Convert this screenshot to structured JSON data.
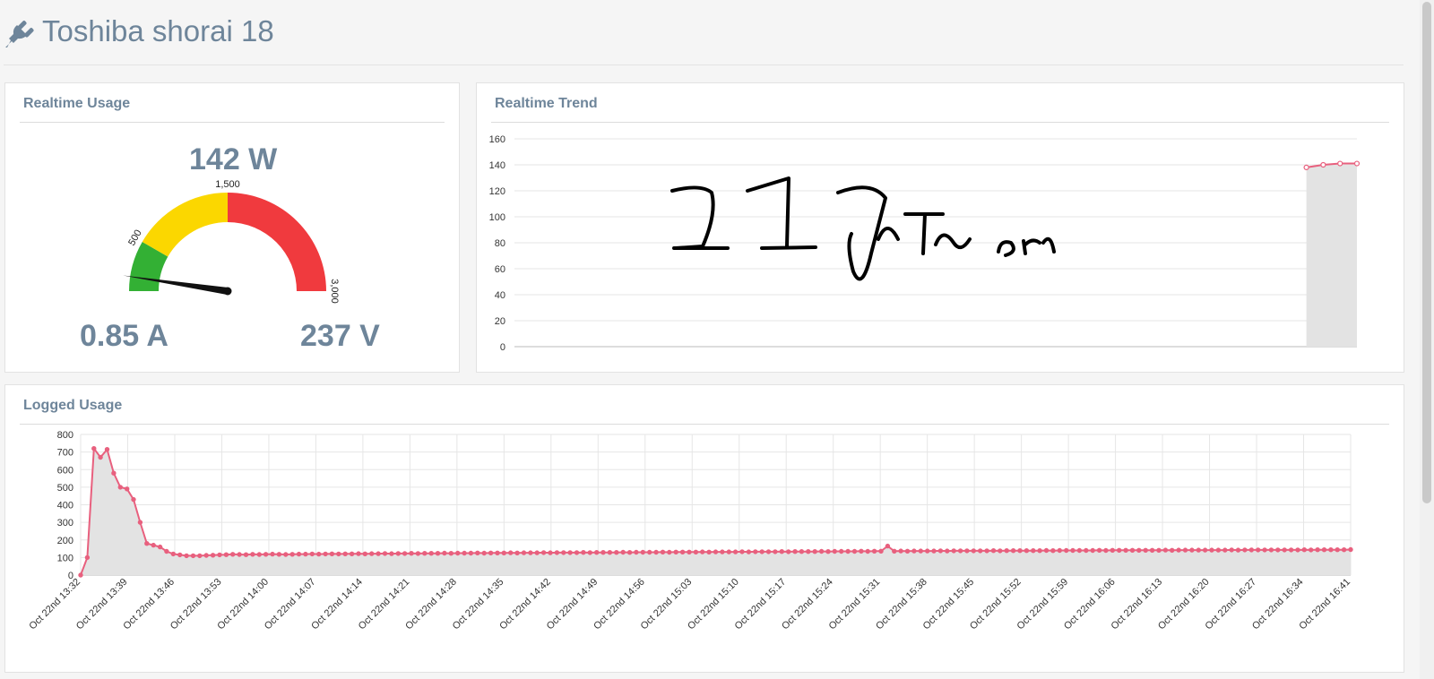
{
  "page": {
    "title": "Toshiba shorai 18",
    "icon": "plug-icon"
  },
  "colors": {
    "text": "#6e859a",
    "line": "#e8607e",
    "fill": "#e3e3e3",
    "gauge_green": "#33b034",
    "gauge_yellow": "#fbd700",
    "gauge_red": "#f03a3e"
  },
  "realtime_usage": {
    "title": "Realtime Usage",
    "watts": "142 W",
    "amps": "0.85 A",
    "volts": "237 V",
    "gauge": {
      "min": 0,
      "max": 3000,
      "value": 142,
      "green_to": 500,
      "yellow_to": 1500,
      "tick_labels": [
        "500",
        "1,500",
        "3,000"
      ]
    }
  },
  "realtime_trend": {
    "title": "Realtime Trend"
  },
  "logged_usage": {
    "title": "Logged Usage"
  },
  "chart_data": [
    {
      "type": "area",
      "title": "Realtime Trend",
      "ylim": [
        0,
        160
      ],
      "y_ticks": [
        "0",
        "20",
        "40",
        "60",
        "80",
        "100",
        "120",
        "140",
        "160"
      ],
      "x_range_slots": 50,
      "series": [
        {
          "x": [
            47,
            48,
            49,
            50
          ],
          "values": [
            138,
            140,
            141,
            141
          ]
        }
      ],
      "annotation": "handwritten overlay (drawn as image)"
    },
    {
      "type": "area",
      "title": "Logged Usage",
      "ylim": [
        0,
        800
      ],
      "y_ticks": [
        "0",
        "100",
        "200",
        "300",
        "400",
        "500",
        "600",
        "700",
        "800"
      ],
      "x_tick_labels": [
        "Oct 22nd 13:32",
        "Oct 22nd 13:39",
        "Oct 22nd 13:46",
        "Oct 22nd 13:53",
        "Oct 22nd 14:00",
        "Oct 22nd 14:07",
        "Oct 22nd 14:14",
        "Oct 22nd 14:21",
        "Oct 22nd 14:28",
        "Oct 22nd 14:35",
        "Oct 22nd 14:42",
        "Oct 22nd 14:49",
        "Oct 22nd 14:56",
        "Oct 22nd 15:03",
        "Oct 22nd 15:10",
        "Oct 22nd 15:17",
        "Oct 22nd 15:24",
        "Oct 22nd 15:31",
        "Oct 22nd 15:38",
        "Oct 22nd 15:45",
        "Oct 22nd 15:52",
        "Oct 22nd 15:59",
        "Oct 22nd 16:06",
        "Oct 22nd 16:13",
        "Oct 22nd 16:20",
        "Oct 22nd 16:27",
        "Oct 22nd 16:34",
        "Oct 22nd 16:41"
      ],
      "x_minutes_span": 189,
      "series": [
        {
          "values": [
            0,
            100,
            720,
            670,
            715,
            580,
            500,
            490,
            430,
            300,
            180,
            170,
            160,
            135,
            120,
            115,
            110,
            110,
            110,
            112,
            113,
            115,
            116,
            118,
            117,
            116,
            118,
            117,
            118,
            119,
            118,
            117,
            118,
            119,
            119,
            120,
            119,
            120,
            121,
            120,
            121,
            121,
            122,
            121,
            122,
            122,
            123,
            122,
            123,
            123,
            124,
            123,
            124,
            124,
            124,
            125,
            124,
            125,
            125,
            125,
            126,
            125,
            126,
            126,
            126,
            127,
            126,
            127,
            127,
            127,
            128,
            127,
            128,
            128,
            128,
            128,
            129,
            128,
            129,
            129,
            129,
            129,
            130,
            129,
            130,
            130,
            130,
            130,
            131,
            130,
            131,
            131,
            131,
            131,
            132,
            131,
            132,
            132,
            132,
            132,
            133,
            132,
            133,
            133,
            133,
            133,
            134,
            133,
            134,
            134,
            134,
            134,
            135,
            134,
            135,
            135,
            135,
            135,
            136,
            135,
            136,
            136,
            165,
            136,
            137,
            136,
            137,
            137,
            137,
            137,
            138,
            137,
            138,
            138,
            138,
            138,
            138,
            138,
            139,
            138,
            139,
            139,
            139,
            139,
            139,
            139,
            140,
            139,
            140,
            140,
            140,
            140,
            140,
            140,
            141,
            140,
            141,
            141,
            141,
            141,
            141,
            141,
            141,
            141,
            142,
            141,
            142,
            142,
            142,
            142,
            142,
            142,
            142,
            142,
            143,
            142,
            143,
            143,
            143,
            143,
            143,
            143,
            143,
            143,
            143,
            144,
            143,
            144,
            144,
            144,
            144,
            144,
            145
          ]
        }
      ]
    }
  ]
}
